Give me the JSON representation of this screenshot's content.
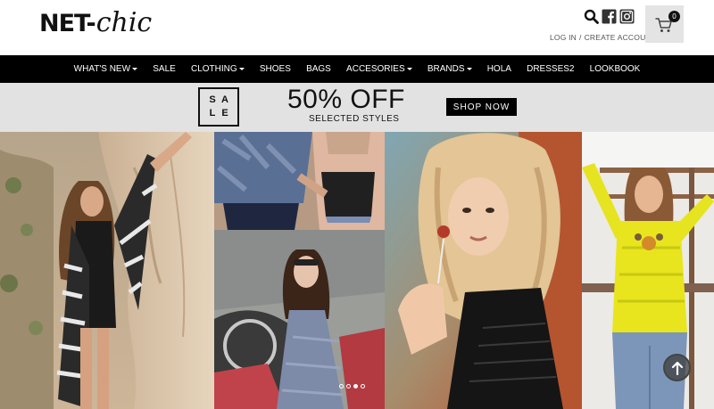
{
  "brand": {
    "logo_part1": "NET-",
    "logo_part2": "chic"
  },
  "header": {
    "login_label": "LOG IN",
    "separator": "/",
    "create_account_label": "CREATE ACCOUNT",
    "cart_count": "0",
    "icons": [
      "search-icon",
      "facebook-icon",
      "instagram-icon",
      "cart-icon"
    ]
  },
  "nav": {
    "items": [
      {
        "label": "WHAT'S NEW",
        "dropdown": true
      },
      {
        "label": "SALE",
        "dropdown": false
      },
      {
        "label": "CLOTHING",
        "dropdown": true
      },
      {
        "label": "SHOES",
        "dropdown": false
      },
      {
        "label": "BAGS",
        "dropdown": false
      },
      {
        "label": "ACCESORIES",
        "dropdown": true
      },
      {
        "label": "BRANDS",
        "dropdown": true
      },
      {
        "label": "HOLA",
        "dropdown": false
      },
      {
        "label": "DRESSES2",
        "dropdown": false
      },
      {
        "label": "LOOKBOOK",
        "dropdown": false
      }
    ]
  },
  "promo": {
    "sale_letters": [
      "S",
      "A",
      "L",
      "E"
    ],
    "headline": "50% OFF",
    "subline": "SELECTED STYLES",
    "cta": "SHOP NOW"
  },
  "slider": {
    "dot_count": 4,
    "active_dot": 2
  },
  "colors": {
    "nav_bg": "#000000",
    "promo_bg": "#e2e2e2",
    "cart_bg": "#e4e4e4"
  }
}
